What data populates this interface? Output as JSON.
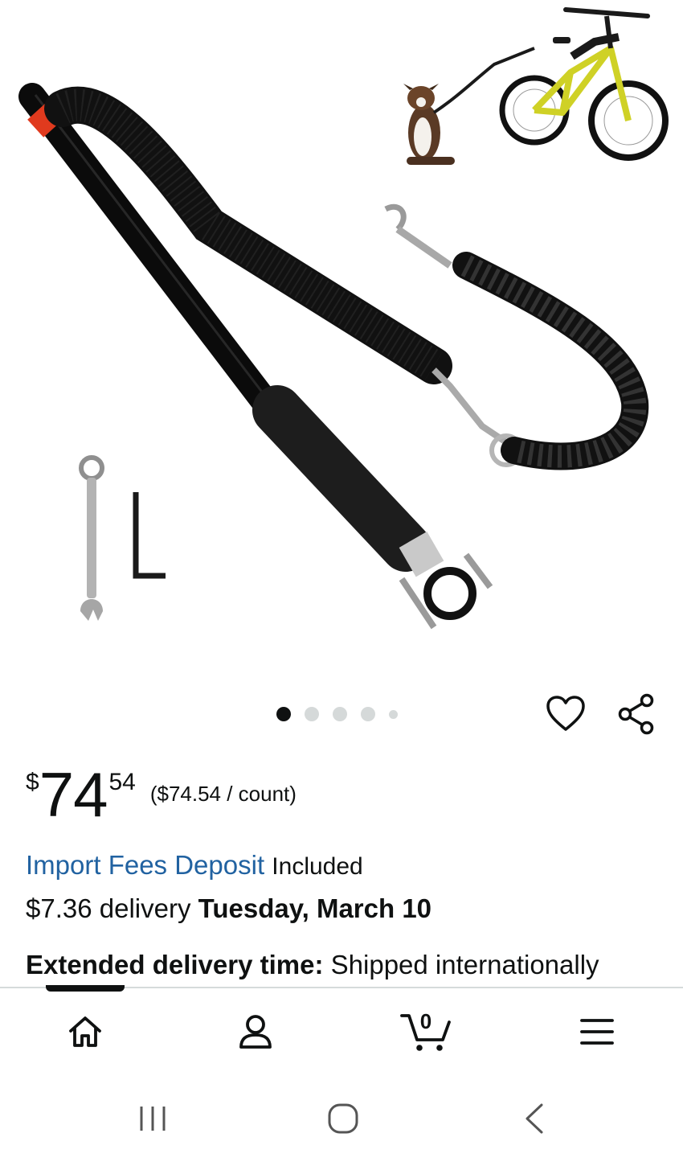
{
  "product_image": {
    "alt_icons": [
      "dog-leash-bike-attachment-photo"
    ]
  },
  "carousel": {
    "count": 5,
    "active_index": 0
  },
  "actions": {
    "favorite_icon": "heart-icon",
    "share_icon": "share-icon"
  },
  "price": {
    "symbol": "$",
    "whole": "74",
    "fraction": "54",
    "per_unit": "($74.54 / count)"
  },
  "import_fees": {
    "link_text": "Import Fees Deposit",
    "status": "Included"
  },
  "delivery": {
    "price_text": "$7.36 delivery",
    "date": "Tuesday, March 10"
  },
  "extended": {
    "label": "Extended delivery time:",
    "text": "Shipped internationally"
  },
  "bottom_nav": {
    "items": [
      "home-icon",
      "account-icon",
      "cart-icon",
      "menu-icon"
    ],
    "cart_count": "0"
  },
  "system_nav": {
    "items": [
      "recents-icon",
      "home-circle-icon",
      "back-icon"
    ]
  },
  "colors": {
    "link": "#2162a1",
    "text": "#0f1111",
    "dot_inactive": "#d5d9d9"
  }
}
